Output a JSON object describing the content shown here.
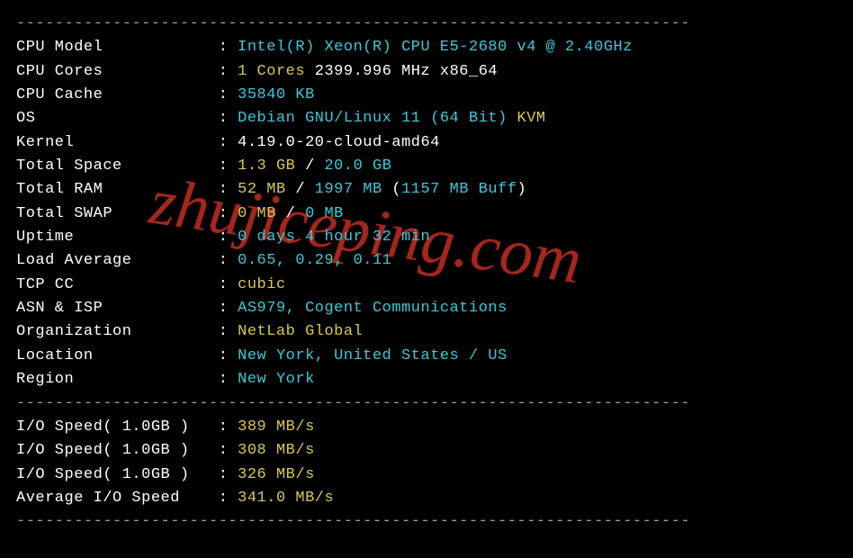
{
  "dashes_top": "----------------------------------------------------------------------",
  "rows": [
    {
      "label": "CPU Model            ",
      "segments": [
        {
          "cls": "cyan",
          "text": "Intel(R) Xeon(R) CPU E5-2680 v4 @ 2.40GHz"
        }
      ]
    },
    {
      "label": "CPU Cores            ",
      "segments": [
        {
          "cls": "yellow",
          "text": "1 Cores "
        },
        {
          "cls": "white",
          "text": "2399.996 MHz x86_64"
        }
      ]
    },
    {
      "label": "CPU Cache            ",
      "segments": [
        {
          "cls": "cyan",
          "text": "35840 KB"
        }
      ]
    },
    {
      "label": "OS                   ",
      "segments": [
        {
          "cls": "cyan",
          "text": "Debian GNU/Linux 11 (64 Bit) "
        },
        {
          "cls": "yellow",
          "text": "KVM"
        }
      ]
    },
    {
      "label": "Kernel               ",
      "segments": [
        {
          "cls": "white",
          "text": "4.19.0-20-cloud-amd64"
        }
      ]
    },
    {
      "label": "Total Space          ",
      "segments": [
        {
          "cls": "yellow",
          "text": "1.3 GB "
        },
        {
          "cls": "white",
          "text": "/ "
        },
        {
          "cls": "cyan",
          "text": "20.0 GB"
        }
      ]
    },
    {
      "label": "Total RAM            ",
      "segments": [
        {
          "cls": "yellow",
          "text": "52 MB "
        },
        {
          "cls": "white",
          "text": "/ "
        },
        {
          "cls": "cyan",
          "text": "1997 MB "
        },
        {
          "cls": "white",
          "text": "("
        },
        {
          "cls": "cyan",
          "text": "1157 MB Buff"
        },
        {
          "cls": "white",
          "text": ")"
        }
      ]
    },
    {
      "label": "Total SWAP           ",
      "segments": [
        {
          "cls": "yellow",
          "text": "0 MB "
        },
        {
          "cls": "white",
          "text": "/ "
        },
        {
          "cls": "cyan",
          "text": "0 MB"
        }
      ]
    },
    {
      "label": "Uptime               ",
      "segments": [
        {
          "cls": "cyan",
          "text": "0 days 4 hour 32 min"
        }
      ]
    },
    {
      "label": "Load Average         ",
      "segments": [
        {
          "cls": "cyan",
          "text": "0.65, 0.29, 0.11"
        }
      ]
    },
    {
      "label": "TCP CC               ",
      "segments": [
        {
          "cls": "yellow",
          "text": "cubic"
        }
      ]
    },
    {
      "label": "ASN & ISP            ",
      "segments": [
        {
          "cls": "cyan",
          "text": "AS979, Cogent Communications"
        }
      ]
    },
    {
      "label": "Organization         ",
      "segments": [
        {
          "cls": "yellow",
          "text": "NetLab Global"
        }
      ]
    },
    {
      "label": "Location             ",
      "segments": [
        {
          "cls": "cyan",
          "text": "New York, United States / US"
        }
      ]
    },
    {
      "label": "Region               ",
      "segments": [
        {
          "cls": "cyan",
          "text": "New York"
        }
      ]
    }
  ],
  "dashes_mid": "----------------------------------------------------------------------",
  "io_rows": [
    {
      "label": "I/O Speed( 1.0GB )   ",
      "value": "389 MB/s"
    },
    {
      "label": "I/O Speed( 1.0GB )   ",
      "value": "308 MB/s"
    },
    {
      "label": "I/O Speed( 1.0GB )   ",
      "value": "326 MB/s"
    },
    {
      "label": "Average I/O Speed    ",
      "value": "341.0 MB/s"
    }
  ],
  "dashes_bot": "----------------------------------------------------------------------",
  "watermark": "zhujiceping.com"
}
